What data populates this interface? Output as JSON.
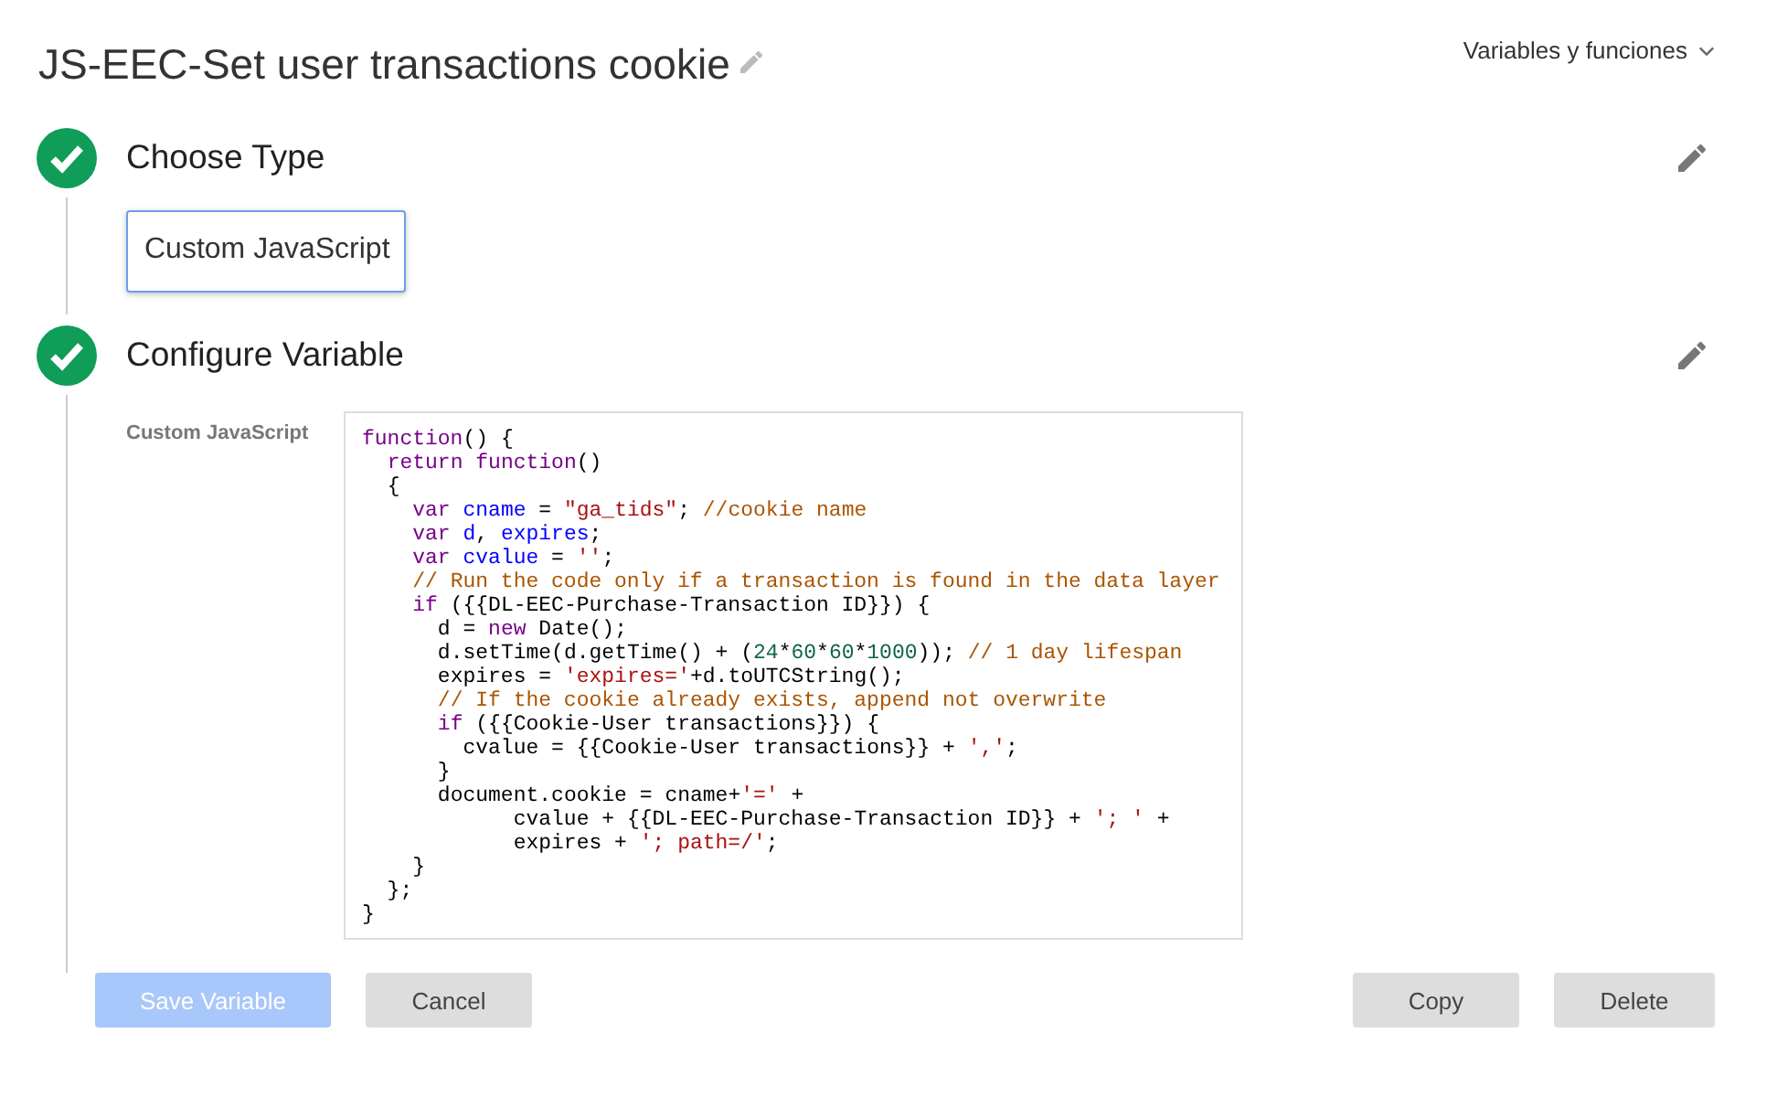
{
  "title": "JS-EEC-Set user transactions cookie",
  "menu": {
    "label": "Variables y funciones"
  },
  "steps": [
    {
      "title": "Choose Type",
      "done": true,
      "kind": "type",
      "type_label": "Custom JavaScript"
    },
    {
      "title": "Configure Variable",
      "done": true,
      "kind": "code",
      "field_label": "Custom JavaScript",
      "code": [
        "function() {",
        "  return function()",
        "  {",
        "    var cname = \"ga_tids\"; //cookie name",
        "    var d, expires;",
        "    var cvalue = '';",
        "    // Run the code only if a transaction is found in the data layer",
        "    if ({{DL-EEC-Purchase-Transaction ID}}) {",
        "      d = new Date();",
        "      d.setTime(d.getTime() + (24*60*60*1000)); // 1 day lifespan",
        "      expires = 'expires='+d.toUTCString();",
        "      // If the cookie already exists, append not overwrite",
        "      if ({{Cookie-User transactions}}) {",
        "        cvalue = {{Cookie-User transactions}} + ',';",
        "      }",
        "      document.cookie = cname+'=' +",
        "            cvalue + {{DL-EEC-Purchase-Transaction ID}} + '; ' +",
        "            expires + '; path=/';",
        "    }",
        "  };",
        "}"
      ]
    }
  ],
  "buttons": [
    {
      "label": "Save Variable",
      "kind": "primary",
      "disabled": true
    },
    {
      "label": "Cancel",
      "kind": "secondary",
      "disabled": false
    },
    {
      "label": "Copy",
      "kind": "secondary",
      "disabled": false
    },
    {
      "label": "Delete",
      "kind": "secondary",
      "disabled": false
    }
  ]
}
